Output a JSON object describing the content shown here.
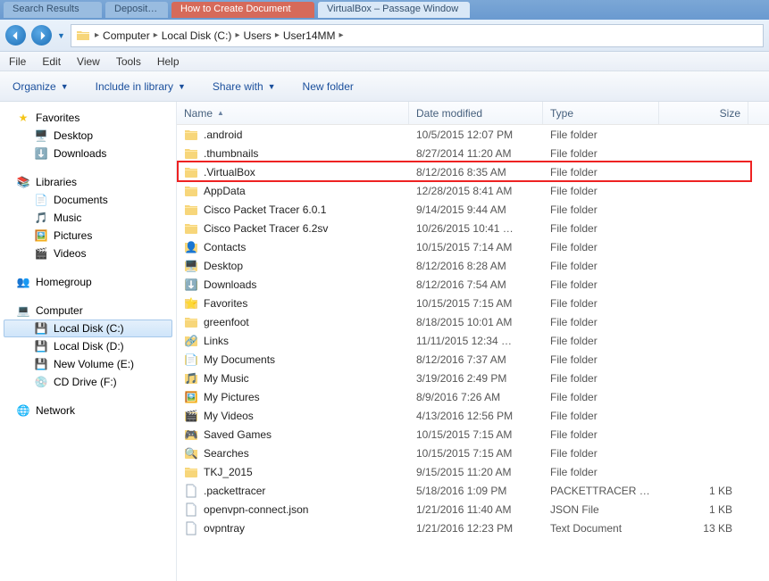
{
  "browser_tabs": [
    {
      "label": "Search Results"
    },
    {
      "label": "Deposit …"
    },
    {
      "label": "How to Create Document"
    },
    {
      "label": "VirtualBox – Passage Window"
    }
  ],
  "breadcrumb": {
    "items": [
      "Computer",
      "Local Disk (C:)",
      "Users",
      "User14MM"
    ]
  },
  "menubar": {
    "file": "File",
    "edit": "Edit",
    "view": "View",
    "tools": "Tools",
    "help": "Help"
  },
  "toolbar": {
    "organize": "Organize",
    "include": "Include in library",
    "share": "Share with",
    "newfolder": "New folder"
  },
  "columns": {
    "name": "Name",
    "date": "Date modified",
    "type": "Type",
    "size": "Size"
  },
  "navpane": {
    "favorites": {
      "label": "Favorites",
      "items": [
        {
          "label": "Desktop"
        },
        {
          "label": "Downloads"
        }
      ]
    },
    "libraries": {
      "label": "Libraries",
      "items": [
        {
          "label": "Documents"
        },
        {
          "label": "Music"
        },
        {
          "label": "Pictures"
        },
        {
          "label": "Videos"
        }
      ]
    },
    "homegroup": {
      "label": "Homegroup"
    },
    "computer": {
      "label": "Computer",
      "items": [
        {
          "label": "Local Disk (C:)",
          "selected": true
        },
        {
          "label": "Local Disk (D:)"
        },
        {
          "label": "New Volume (E:)"
        },
        {
          "label": "CD Drive (F:)"
        }
      ]
    },
    "network": {
      "label": "Network"
    }
  },
  "files": [
    {
      "name": ".android",
      "date": "10/5/2015 12:07 PM",
      "type": "File folder",
      "size": "",
      "icon": "folder"
    },
    {
      "name": ".thumbnails",
      "date": "8/27/2014 11:20 AM",
      "type": "File folder",
      "size": "",
      "icon": "folder"
    },
    {
      "name": ".VirtualBox",
      "date": "8/12/2016 8:35 AM",
      "type": "File folder",
      "size": "",
      "icon": "folder",
      "highlight": true
    },
    {
      "name": "AppData",
      "date": "12/28/2015 8:41 AM",
      "type": "File folder",
      "size": "",
      "icon": "folder"
    },
    {
      "name": "Cisco Packet Tracer 6.0.1",
      "date": "9/14/2015 9:44 AM",
      "type": "File folder",
      "size": "",
      "icon": "folder"
    },
    {
      "name": "Cisco Packet Tracer 6.2sv",
      "date": "10/26/2015 10:41 …",
      "type": "File folder",
      "size": "",
      "icon": "folder"
    },
    {
      "name": "Contacts",
      "date": "10/15/2015 7:14 AM",
      "type": "File folder",
      "size": "",
      "icon": "contacts"
    },
    {
      "name": "Desktop",
      "date": "8/12/2016 8:28 AM",
      "type": "File folder",
      "size": "",
      "icon": "desktop"
    },
    {
      "name": "Downloads",
      "date": "8/12/2016 7:54 AM",
      "type": "File folder",
      "size": "",
      "icon": "downloads"
    },
    {
      "name": "Favorites",
      "date": "10/15/2015 7:15 AM",
      "type": "File folder",
      "size": "",
      "icon": "favorites"
    },
    {
      "name": "greenfoot",
      "date": "8/18/2015 10:01 AM",
      "type": "File folder",
      "size": "",
      "icon": "folder"
    },
    {
      "name": "Links",
      "date": "11/11/2015 12:34 …",
      "type": "File folder",
      "size": "",
      "icon": "links"
    },
    {
      "name": "My Documents",
      "date": "8/12/2016 7:37 AM",
      "type": "File folder",
      "size": "",
      "icon": "documents"
    },
    {
      "name": "My Music",
      "date": "3/19/2016 2:49 PM",
      "type": "File folder",
      "size": "",
      "icon": "music"
    },
    {
      "name": "My Pictures",
      "date": "8/9/2016 7:26 AM",
      "type": "File folder",
      "size": "",
      "icon": "pictures"
    },
    {
      "name": "My Videos",
      "date": "4/13/2016 12:56 PM",
      "type": "File folder",
      "size": "",
      "icon": "videos"
    },
    {
      "name": "Saved Games",
      "date": "10/15/2015 7:15 AM",
      "type": "File folder",
      "size": "",
      "icon": "savedgames"
    },
    {
      "name": "Searches",
      "date": "10/15/2015 7:15 AM",
      "type": "File folder",
      "size": "",
      "icon": "searches"
    },
    {
      "name": "TKJ_2015",
      "date": "9/15/2015 11:20 AM",
      "type": "File folder",
      "size": "",
      "icon": "folder"
    },
    {
      "name": ".packettracer",
      "date": "5/18/2016 1:09 PM",
      "type": "PACKETTRACER F…",
      "size": "1 KB",
      "icon": "file"
    },
    {
      "name": "openvpn-connect.json",
      "date": "1/21/2016 11:40 AM",
      "type": "JSON File",
      "size": "1 KB",
      "icon": "file"
    },
    {
      "name": "ovpntray",
      "date": "1/21/2016 12:23 PM",
      "type": "Text Document",
      "size": "13 KB",
      "icon": "file"
    }
  ],
  "highlight_box": {
    "row_index": 2
  }
}
